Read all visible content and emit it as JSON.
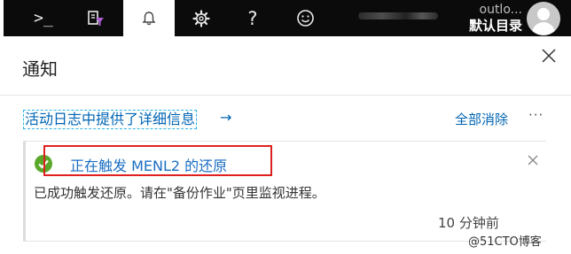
{
  "topbar": {
    "cloud_shell_glyph": ">_",
    "help_glyph": "?",
    "account_line1": "outlo...",
    "account_line2": "默认目录"
  },
  "panel": {
    "title": "通知",
    "activity_log_link": "活动日志中提供了详细信息",
    "activity_log_arrow": "→",
    "clear_all": "全部消除",
    "more": "···"
  },
  "notification": {
    "title": "正在触发 MENL2 的还原",
    "body": "已成功触发还原。请在\"备份作业\"页里监视进程。",
    "time": "10 分钟前",
    "status": "success"
  },
  "watermark": "@51CTO博客",
  "colors": {
    "topbar": "#0b0b0b",
    "link": "#0064b4",
    "success": "#5aa82a",
    "highlight": "#e02020"
  }
}
